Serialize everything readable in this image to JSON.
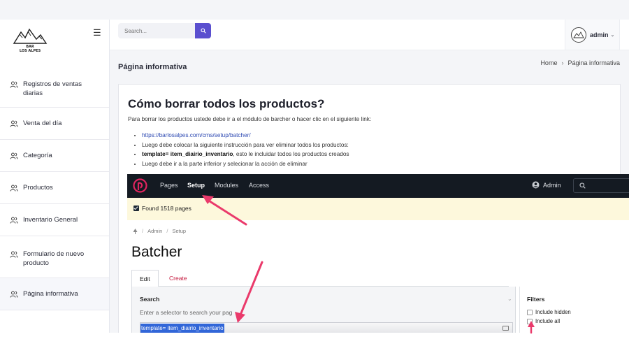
{
  "sidebar": {
    "logo_text": "BAR LOS ALPES",
    "menu_icon": "hamburger-icon",
    "items": [
      {
        "label": "Registros de ventas diarias",
        "icon": "users-icon"
      },
      {
        "label": "Venta del día",
        "icon": "users-icon"
      },
      {
        "label": "Categoría",
        "icon": "users-icon"
      },
      {
        "label": "Productos",
        "icon": "users-icon"
      },
      {
        "label": "Inventario General",
        "icon": "users-icon"
      },
      {
        "label": "Formulario de nuevo producto",
        "icon": "users-icon"
      },
      {
        "label": "Página informativa",
        "icon": "users-icon",
        "active": true
      }
    ]
  },
  "topbar": {
    "search_placeholder": "Search...",
    "search_icon": "search-icon",
    "user_name": "admin",
    "accent": "#5a4fcf"
  },
  "page": {
    "title": "Página informativa",
    "breadcrumb": {
      "home": "Home",
      "current": "Página informativa"
    }
  },
  "article": {
    "heading": "Cómo borrar todos los productos?",
    "intro": "Para borrar los productos ustede debe ir a el módulo de barcher o hacer clic en el siguiente link:",
    "link": "https://barlosalpes.com/cms/setup/batcher/",
    "step2": "Luego debe colocar la siguiente instrucción para ver eliminar todos los productos:",
    "step3_bold": "template= item_diairio_inventario",
    "step3_rest": ", esto le incluidar todos los productos creados",
    "step4": "Luego debe ir a la parte inferior y selecionar la acción de eliminar"
  },
  "embed": {
    "nav": [
      "Pages",
      "Setup",
      "Modules",
      "Access"
    ],
    "active_nav": "Setup",
    "admin": "Admin",
    "notice": "Found 1518 pages",
    "crumbs": [
      "Admin",
      "Setup"
    ],
    "title": "Batcher",
    "tabs": [
      "Edit",
      "Create"
    ],
    "panel_head": "Search",
    "hint": "Enter a selector to search your pag",
    "selected_text": "template= item_diairio_inventario",
    "filters_head": "Filters",
    "filters": [
      "Include hidden",
      "Include all"
    ],
    "brand_color": "#e0245e",
    "arrow_color": "#ea3a6b"
  }
}
